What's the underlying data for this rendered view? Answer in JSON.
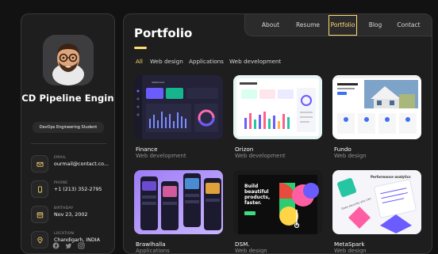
{
  "colors": {
    "accent": "#ffdb70",
    "background": "#121212",
    "panel": "#1e1e1f"
  },
  "sidebar": {
    "avatar_icon": "memoji-avatar",
    "name": "I/CD Pipeline Enginee",
    "role": "DevOps Engineering Student",
    "contacts": [
      {
        "icon": "mail-icon",
        "label": "EMAIL",
        "value": "ourmail@contact.co..."
      },
      {
        "icon": "phone-icon",
        "label": "PHONE",
        "value": "+1 (213) 352-2795"
      },
      {
        "icon": "calendar-icon",
        "label": "BIRTHDAY",
        "value": "Nov 23, 2002"
      },
      {
        "icon": "location-icon",
        "label": "LOCATION",
        "value": "Chandigarh, INDIA"
      }
    ],
    "socials": [
      "facebook-icon",
      "twitter-icon",
      "instagram-icon"
    ]
  },
  "navbar": {
    "items": [
      "About",
      "Resume",
      "Portfolio",
      "Blog",
      "Contact"
    ],
    "active": "Portfolio"
  },
  "portfolio": {
    "title": "Portfolio",
    "filters": [
      "All",
      "Web design",
      "Applications",
      "Web development"
    ],
    "active_filter": "All",
    "projects": [
      {
        "title": "Finance",
        "category": "Web development"
      },
      {
        "title": "Orizon",
        "category": "Web development"
      },
      {
        "title": "Fundo",
        "category": "Web design"
      },
      {
        "title": "Brawlhalla",
        "category": "Applications"
      },
      {
        "title": "DSM.",
        "category": "Web design"
      },
      {
        "title": "MetaSpark",
        "category": "Web design"
      }
    ],
    "thumb_texts": {
      "dsm_headline_1": "Build",
      "dsm_headline_2": "beautiful",
      "dsm_headline_3": "products,",
      "dsm_headline_4": "faster.",
      "metaspark_1": "Performance analytics",
      "metaspark_2": "Data security you can",
      "finance_brand": "dashboard"
    }
  }
}
